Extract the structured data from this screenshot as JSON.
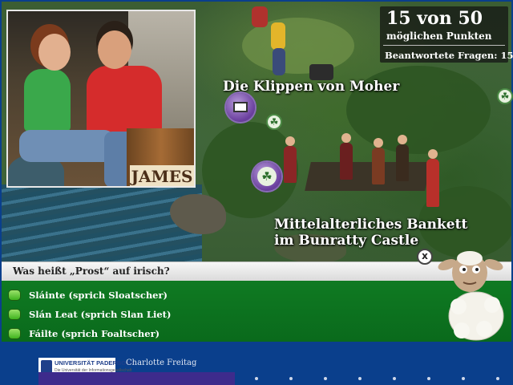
{
  "score": {
    "headline": "15 von 50",
    "subline": "möglichen Punkten",
    "answered": "Beantwortete Fragen: 15"
  },
  "locations": {
    "cliffs": "Die Klippen von Moher",
    "banquet_line1": "Mittelalterliches Bankett",
    "banquet_line2": "im Bunratty Castle"
  },
  "photo": {
    "barrel_text": "JAMES"
  },
  "quiz": {
    "question": "Was heißt „Prost“ auf irisch?",
    "close_label": "x",
    "answers": [
      "Sláinte (sprich Sloatscher)",
      "Slán Leat (sprich Slan Liet)",
      "Fáilte (sprich Foaltscher)"
    ]
  },
  "footer": {
    "logo_name": "UNIVERSITÄT PADERBORN",
    "logo_sub": "Die Universität der Informationsgesellschaft",
    "author": "Charlotte Freitag"
  },
  "icons": {
    "tv": "tv-icon",
    "clover": "shamrock-icon",
    "close": "close-icon",
    "mascot": "sheep-mascot"
  }
}
